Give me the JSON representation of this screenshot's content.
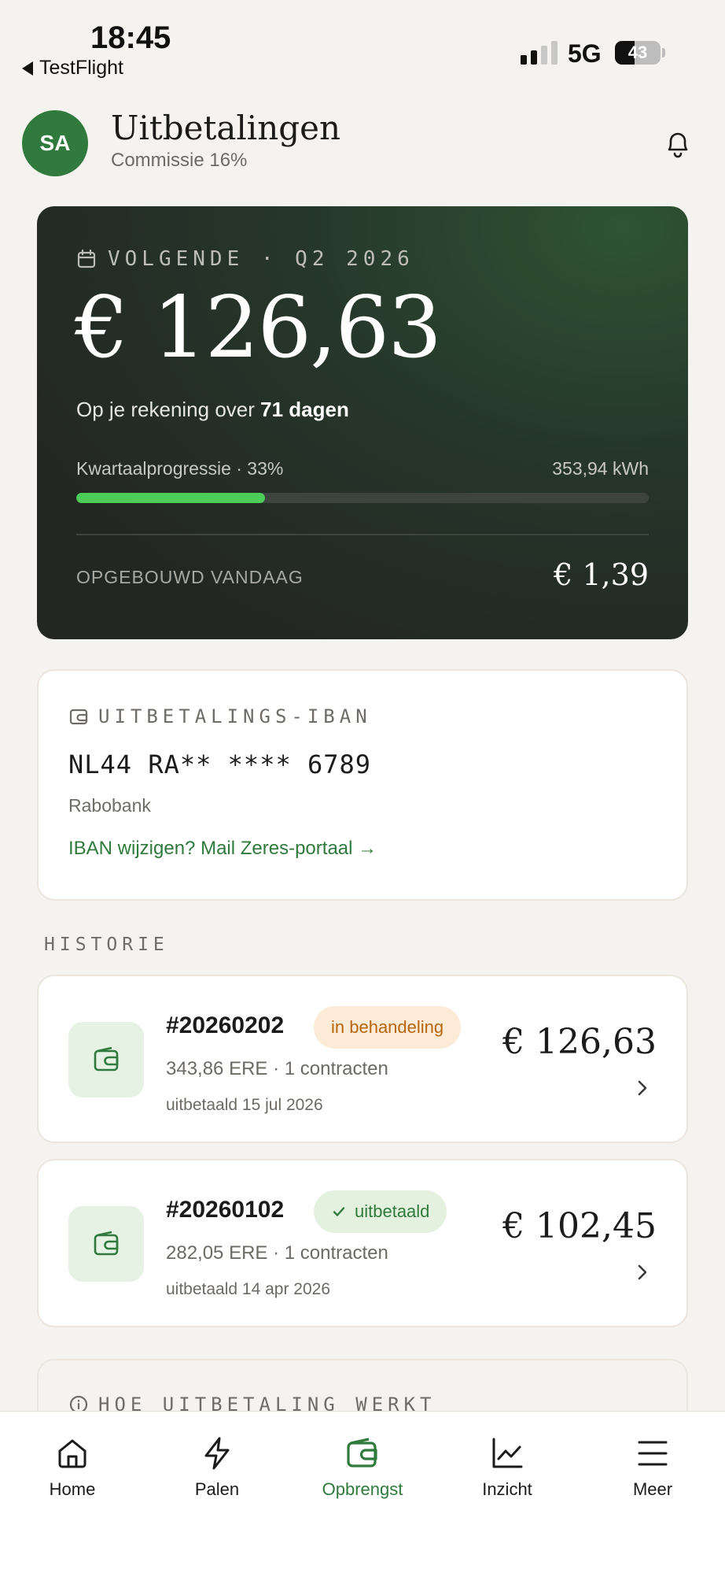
{
  "status_bar": {
    "time": "18:45",
    "back_app": "TestFlight",
    "network": "5G",
    "battery_level": "43",
    "battery_fraction": 0.43
  },
  "header": {
    "avatar_initials": "SA",
    "title": "Uitbetalingen",
    "subtitle": "Commissie 16%"
  },
  "hero": {
    "eyebrow": "VOLGENDE · Q2 2026",
    "amount": "€ 126,63",
    "days_prefix": "Op je rekening over ",
    "days_value": "71 dagen",
    "progress_label": "Kwartaalprogressie · 33%",
    "progress_value": 33,
    "progress_kwh": "353,94 kWh",
    "today_label": "OPGEBOUWD VANDAAG",
    "today_value": "€ 1,39"
  },
  "iban": {
    "eyebrow": "UITBETALINGS-IBAN",
    "number": "NL44 RA** **** 6789",
    "bank": "Rabobank",
    "link": "IBAN wijzigen? Mail Zeres-portaal →"
  },
  "history": {
    "title": "HISTORIE",
    "items": [
      {
        "id": "#20260202",
        "status": "in behandeling",
        "meta": "343,86 ERE · 1 contracten",
        "date": "uitbetaald 15 jul 2026",
        "amount": "€ 126,63"
      },
      {
        "id": "#20260102",
        "status": "uitbetaald",
        "meta": "282,05 ERE · 1 contracten",
        "date": "uitbetaald 14 apr 2026",
        "amount": "€ 102,45"
      }
    ]
  },
  "info_card": {
    "title": "HOE UITBETALING WERKT"
  },
  "tabbar": {
    "items": [
      {
        "label": "Home",
        "icon": "home-icon"
      },
      {
        "label": "Palen",
        "icon": "bolt-icon"
      },
      {
        "label": "Opbrengst",
        "icon": "wallet-icon"
      },
      {
        "label": "Inzicht",
        "icon": "chart-icon"
      },
      {
        "label": "Meer",
        "icon": "menu-icon"
      }
    ],
    "active": "Opbrengst"
  },
  "colors": {
    "accent": "#2f7a3c",
    "progress": "#4ccd57",
    "pending_text": "#b8650c",
    "pending_bg": "#fbebd7",
    "paid_bg": "#e3f1de",
    "background": "#f5f3ef"
  }
}
